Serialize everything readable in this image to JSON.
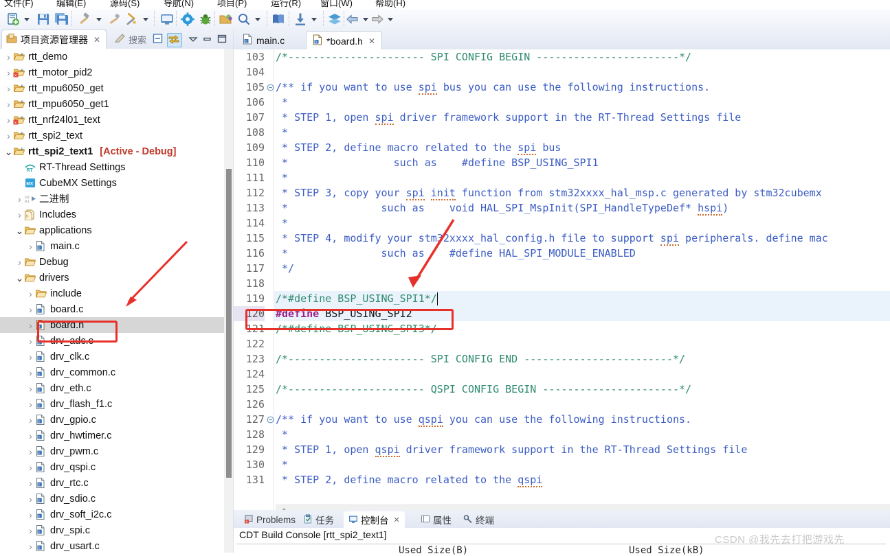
{
  "menu": {
    "items": [
      "文件(F)",
      "编辑(E)",
      "源码(S)",
      "导航(N)",
      "项目(P)",
      "运行(R)",
      "窗口(W)",
      "帮助(H)"
    ]
  },
  "toolbar": {
    "icons": [
      "new-file-icon",
      "new-dropdown-caret",
      "save-icon",
      "save-all-icon",
      "build-hammer-icon",
      "build-dropdown-caret",
      "clean-icon",
      "build-settings-icon",
      "build-settings-caret",
      "monitor-icon",
      "gear-icon",
      "debug-bug-icon",
      "open-resource-icon",
      "search-icon",
      "search-caret",
      "book-icon",
      "download-icon",
      "download-caret",
      "layers-icon",
      "back-arrow-icon",
      "back-caret",
      "forward-arrow-icon",
      "forward-caret"
    ]
  },
  "project_explorer": {
    "tab_label": "项目资源管理器",
    "tab_close": "✕",
    "search_label": "搜索",
    "buttons": [
      "collapse-all-icon",
      "link-with-editor-icon",
      "view-menu-icon",
      "minimize-icon",
      "maximize-icon"
    ],
    "tree": [
      {
        "label": "rtt_demo",
        "depth": 0,
        "arrow": "collapsed",
        "icon": "c-project-folder-icon",
        "bold": false
      },
      {
        "label": "rtt_motor_pid2",
        "depth": 0,
        "arrow": "collapsed",
        "icon": "c-project-folder-error-icon",
        "bold": false
      },
      {
        "label": "rtt_mpu6050_get",
        "depth": 0,
        "arrow": "collapsed",
        "icon": "c-project-folder-icon",
        "bold": false
      },
      {
        "label": "rtt_mpu6050_get1",
        "depth": 0,
        "arrow": "collapsed",
        "icon": "c-project-folder-icon",
        "bold": false
      },
      {
        "label": "rtt_nrf24l01_text",
        "depth": 0,
        "arrow": "collapsed",
        "icon": "c-project-folder-error-icon",
        "bold": false
      },
      {
        "label": "rtt_spi2_text",
        "depth": 0,
        "arrow": "collapsed",
        "icon": "c-project-folder-icon",
        "bold": false
      },
      {
        "label": "rtt_spi2_text1",
        "depth": 0,
        "arrow": "expanded",
        "icon": "c-project-folder-icon",
        "bold": true,
        "suffix": "[Active - Debug]"
      },
      {
        "label": "RT-Thread Settings",
        "depth": 1,
        "arrow": "none",
        "icon": "rt-thread-settings-icon",
        "bold": false
      },
      {
        "label": "CubeMX Settings",
        "depth": 1,
        "arrow": "none",
        "icon": "cubemx-settings-icon",
        "bold": false
      },
      {
        "label": "二进制",
        "depth": 1,
        "arrow": "collapsed",
        "icon": "binaries-icon",
        "bold": false
      },
      {
        "label": "Includes",
        "depth": 1,
        "arrow": "collapsed",
        "icon": "includes-icon",
        "bold": false
      },
      {
        "label": "applications",
        "depth": 1,
        "arrow": "expanded",
        "icon": "source-folder-icon",
        "bold": false
      },
      {
        "label": "main.c",
        "depth": 2,
        "arrow": "collapsed",
        "icon": "c-file-icon",
        "bold": false
      },
      {
        "label": "Debug",
        "depth": 1,
        "arrow": "collapsed",
        "icon": "source-folder-icon",
        "bold": false
      },
      {
        "label": "drivers",
        "depth": 1,
        "arrow": "expanded",
        "icon": "source-folder-icon",
        "bold": false
      },
      {
        "label": "include",
        "depth": 2,
        "arrow": "collapsed",
        "icon": "source-folder-icon",
        "bold": false
      },
      {
        "label": "board.c",
        "depth": 2,
        "arrow": "collapsed",
        "icon": "c-file-icon",
        "bold": false
      },
      {
        "label": "board.h",
        "depth": 2,
        "arrow": "collapsed",
        "icon": "h-file-icon",
        "bold": false,
        "selected": true
      },
      {
        "label": "drv_adc.c",
        "depth": 2,
        "arrow": "collapsed",
        "icon": "c-file-icon",
        "bold": false
      },
      {
        "label": "drv_clk.c",
        "depth": 2,
        "arrow": "collapsed",
        "icon": "c-file-icon",
        "bold": false
      },
      {
        "label": "drv_common.c",
        "depth": 2,
        "arrow": "collapsed",
        "icon": "c-file-icon",
        "bold": false
      },
      {
        "label": "drv_eth.c",
        "depth": 2,
        "arrow": "collapsed",
        "icon": "c-file-icon",
        "bold": false
      },
      {
        "label": "drv_flash_f1.c",
        "depth": 2,
        "arrow": "collapsed",
        "icon": "c-file-icon",
        "bold": false
      },
      {
        "label": "drv_gpio.c",
        "depth": 2,
        "arrow": "collapsed",
        "icon": "c-file-icon",
        "bold": false
      },
      {
        "label": "drv_hwtimer.c",
        "depth": 2,
        "arrow": "collapsed",
        "icon": "c-file-icon",
        "bold": false
      },
      {
        "label": "drv_pwm.c",
        "depth": 2,
        "arrow": "collapsed",
        "icon": "c-file-icon",
        "bold": false
      },
      {
        "label": "drv_qspi.c",
        "depth": 2,
        "arrow": "collapsed",
        "icon": "c-file-icon",
        "bold": false
      },
      {
        "label": "drv_rtc.c",
        "depth": 2,
        "arrow": "collapsed",
        "icon": "c-file-icon",
        "bold": false
      },
      {
        "label": "drv_sdio.c",
        "depth": 2,
        "arrow": "collapsed",
        "icon": "c-file-icon",
        "bold": false
      },
      {
        "label": "drv_soft_i2c.c",
        "depth": 2,
        "arrow": "collapsed",
        "icon": "c-file-icon",
        "bold": false
      },
      {
        "label": "drv_spi.c",
        "depth": 2,
        "arrow": "collapsed",
        "icon": "c-file-icon",
        "bold": false
      },
      {
        "label": "drv_usart.c",
        "depth": 2,
        "arrow": "collapsed",
        "icon": "c-file-icon",
        "bold": false
      }
    ]
  },
  "editor": {
    "tabs": [
      {
        "label": "main.c",
        "icon": "c-file-icon",
        "selected": false,
        "close": ""
      },
      {
        "label": "*board.h",
        "icon": "h-file-icon",
        "selected": true,
        "close": "✕"
      }
    ],
    "first_line": 103,
    "highlighted_line": 120,
    "caret_line": 119,
    "lines": [
      {
        "n": 103,
        "fold": "",
        "segs": [
          {
            "t": "/*---------------------- SPI CONFIG BEGIN -----------------------*/",
            "c": "cmt"
          }
        ]
      },
      {
        "n": 104,
        "fold": "",
        "segs": []
      },
      {
        "n": 105,
        "fold": "-",
        "segs": [
          {
            "t": "/** if you want to use ",
            "c": "doc"
          },
          {
            "t": "spi",
            "c": "doc sq"
          },
          {
            "t": " bus you can use the following instructions.",
            "c": "doc"
          }
        ]
      },
      {
        "n": 106,
        "fold": "",
        "segs": [
          {
            "t": " *",
            "c": "doc"
          }
        ]
      },
      {
        "n": 107,
        "fold": "",
        "segs": [
          {
            "t": " * STEP 1, open ",
            "c": "doc"
          },
          {
            "t": "spi",
            "c": "doc sq"
          },
          {
            "t": " driver framework support in the RT-Thread Settings file",
            "c": "doc"
          }
        ]
      },
      {
        "n": 108,
        "fold": "",
        "segs": [
          {
            "t": " *",
            "c": "doc"
          }
        ]
      },
      {
        "n": 109,
        "fold": "",
        "segs": [
          {
            "t": " * STEP 2, define macro related to the ",
            "c": "doc"
          },
          {
            "t": "spi",
            "c": "doc sq"
          },
          {
            "t": " bus",
            "c": "doc"
          }
        ]
      },
      {
        "n": 110,
        "fold": "",
        "segs": [
          {
            "t": " *                 such as    #define BSP_USING_SPI1",
            "c": "doc"
          }
        ]
      },
      {
        "n": 111,
        "fold": "",
        "segs": [
          {
            "t": " *",
            "c": "doc"
          }
        ]
      },
      {
        "n": 112,
        "fold": "",
        "segs": [
          {
            "t": " * STEP 3, copy your ",
            "c": "doc"
          },
          {
            "t": "spi",
            "c": "doc sq"
          },
          {
            "t": " ",
            "c": "doc"
          },
          {
            "t": "init",
            "c": "doc sq"
          },
          {
            "t": " function from stm32xxxx_hal_msp.c generated by stm32cubemx",
            "c": "doc"
          }
        ]
      },
      {
        "n": 113,
        "fold": "",
        "segs": [
          {
            "t": " *               such as    void HAL_SPI_MspInit(SPI_HandleTypeDef* ",
            "c": "doc"
          },
          {
            "t": "hspi",
            "c": "doc sq"
          },
          {
            "t": ")",
            "c": "doc"
          }
        ]
      },
      {
        "n": 114,
        "fold": "",
        "segs": [
          {
            "t": " *",
            "c": "doc"
          }
        ]
      },
      {
        "n": 115,
        "fold": "",
        "segs": [
          {
            "t": " * STEP 4, modify your stm32xxxx_hal_config.h file to support ",
            "c": "doc"
          },
          {
            "t": "spi",
            "c": "doc sq"
          },
          {
            "t": " peripherals. define mac",
            "c": "doc"
          }
        ]
      },
      {
        "n": 116,
        "fold": "",
        "segs": [
          {
            "t": " *               such as    #define HAL_SPI_MODULE_ENABLED",
            "c": "doc"
          }
        ]
      },
      {
        "n": 117,
        "fold": "",
        "segs": [
          {
            "t": " */",
            "c": "doc"
          }
        ]
      },
      {
        "n": 118,
        "fold": "",
        "segs": []
      },
      {
        "n": 119,
        "fold": "",
        "segs": [
          {
            "t": "/*#define BSP_USING_SPI1*/",
            "c": "cmt"
          }
        ]
      },
      {
        "n": 120,
        "fold": "",
        "segs": [
          {
            "t": "#define",
            "c": "pre"
          },
          {
            "t": " BSP_USING_SPI2",
            "c": "txt"
          }
        ]
      },
      {
        "n": 121,
        "fold": "",
        "segs": [
          {
            "t": "/*#define BSP_USING_SPI3*/",
            "c": "cmt"
          }
        ]
      },
      {
        "n": 122,
        "fold": "",
        "segs": []
      },
      {
        "n": 123,
        "fold": "",
        "segs": [
          {
            "t": "/*---------------------- SPI CONFIG END ------------------------*/",
            "c": "cmt"
          }
        ]
      },
      {
        "n": 124,
        "fold": "",
        "segs": []
      },
      {
        "n": 125,
        "fold": "",
        "segs": [
          {
            "t": "/*---------------------- QSPI CONFIG BEGIN ----------------------*/",
            "c": "cmt"
          }
        ]
      },
      {
        "n": 126,
        "fold": "",
        "segs": []
      },
      {
        "n": 127,
        "fold": "-",
        "segs": [
          {
            "t": "/** if you want to use ",
            "c": "doc"
          },
          {
            "t": "qspi",
            "c": "doc sq"
          },
          {
            "t": " you can use the following instructions.",
            "c": "doc"
          }
        ]
      },
      {
        "n": 128,
        "fold": "",
        "segs": [
          {
            "t": " *",
            "c": "doc"
          }
        ]
      },
      {
        "n": 129,
        "fold": "",
        "segs": [
          {
            "t": " * STEP 1, open ",
            "c": "doc"
          },
          {
            "t": "qspi",
            "c": "doc sq"
          },
          {
            "t": " driver framework support in the RT-Thread Settings file",
            "c": "doc"
          }
        ]
      },
      {
        "n": 130,
        "fold": "",
        "segs": [
          {
            "t": " *",
            "c": "doc"
          }
        ]
      },
      {
        "n": 131,
        "fold": "",
        "segs": [
          {
            "t": " * STEP 2, define macro related to the ",
            "c": "doc"
          },
          {
            "t": "qspi",
            "c": "doc sq"
          }
        ]
      }
    ]
  },
  "bottom_panel": {
    "tabs": [
      {
        "label": "Problems",
        "icon": "problems-icon",
        "selected": false
      },
      {
        "label": "任务",
        "icon": "tasks-icon",
        "selected": false
      },
      {
        "label": "控制台",
        "icon": "console-icon",
        "selected": true,
        "close": "✕"
      },
      {
        "label": "属性",
        "icon": "properties-icon",
        "selected": false
      },
      {
        "label": "终端",
        "icon": "terminal-icon",
        "selected": false
      }
    ],
    "console_title": "CDT Build Console [rtt_spi2_text1]",
    "console_line_left": "Used Size(B)",
    "console_line_right": "Used Size(kB)"
  },
  "annotations": {
    "box_board_h": "board.h",
    "box_define": "#define BSP_USING_SPI2",
    "arrow_color": "#e8302a"
  },
  "watermark": "CSDN @我先去打把游戏先",
  "colors": {
    "accent": "#3b5cc4",
    "comment_green": "#2e8b70",
    "preprocessor": "#9b1f8c",
    "annotation_red": "#e8302a",
    "active_debug": "#c0392b",
    "highlight_row": "#eaf2fb"
  }
}
